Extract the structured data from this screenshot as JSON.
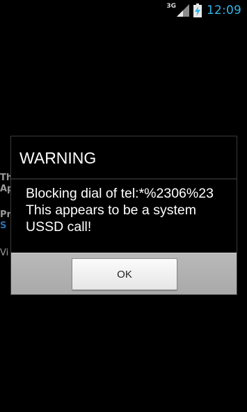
{
  "status_bar": {
    "network_type": "3G",
    "time": "12:09",
    "clock_color": "#33b5e5",
    "icons": [
      "signal-icon",
      "battery-charging-icon"
    ]
  },
  "background_app": {
    "lines": [
      "Th",
      "Ap",
      "Pr",
      "S",
      "Vi"
    ]
  },
  "dialog": {
    "title": "WARNING",
    "message_lines": [
      "Blocking dial of tel:*%2306%23",
      "This appears to be a system",
      "USSD call!"
    ],
    "ok_label": "OK"
  }
}
